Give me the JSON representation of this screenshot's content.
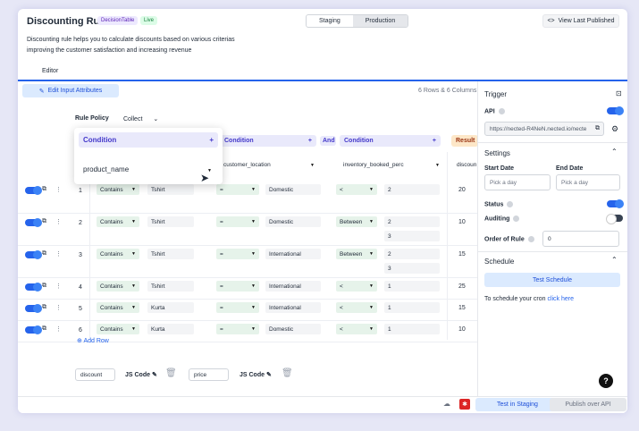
{
  "header": {
    "title": "Discounting Rule",
    "badge_type": "DecisionTable",
    "badge_status": "Live",
    "env_staging": "Staging",
    "env_production": "Production",
    "view_published": "View Last Published",
    "description_line1": "Discounting rule helps you to calculate discounts based on various criterias",
    "description_line2": "improving the customer satisfaction and increasing revenue",
    "tab_editor": "Editor"
  },
  "toolbar": {
    "edit_input": "Edit Input Attributes",
    "size_info": "6 Rows & 6 Columns"
  },
  "policy": {
    "label": "Rule Policy",
    "value": "Collect"
  },
  "columns": {
    "condition_label": "Condition",
    "and_label": "And",
    "result_label": "Result",
    "col1_attr": "product_name",
    "col2_attr": "customer_location",
    "col3_attr": "inventory_booked_perc",
    "col4_attr": "discoun"
  },
  "rows": [
    {
      "num": "1",
      "op1": "Contains",
      "v1": "Tshirt",
      "op2": "=",
      "v2": "Domestic",
      "op3": "<",
      "v3": "2",
      "v3b": "",
      "res": "20"
    },
    {
      "num": "2",
      "op1": "Contains",
      "v1": "Tshirt",
      "op2": "=",
      "v2": "Domestic",
      "op3": "Between",
      "v3": "2",
      "v3b": "3",
      "res": "10"
    },
    {
      "num": "3",
      "op1": "Contains",
      "v1": "Tshirt",
      "op2": "=",
      "v2": "International",
      "op3": "Between",
      "v3": "2",
      "v3b": "3",
      "res": "15"
    },
    {
      "num": "4",
      "op1": "Contains",
      "v1": "Tshirt",
      "op2": "=",
      "v2": "International",
      "op3": "<",
      "v3": "1",
      "v3b": "",
      "res": "25"
    },
    {
      "num": "5",
      "op1": "Contains",
      "v1": "Kurta",
      "op2": "=",
      "v2": "International",
      "op3": "<",
      "v3": "1",
      "v3b": "",
      "res": "15"
    },
    {
      "num": "6",
      "op1": "Contains",
      "v1": "Kurta",
      "op2": "=",
      "v2": "Domestic",
      "op3": "<",
      "v3": "1",
      "v3b": "",
      "res": "10"
    }
  ],
  "add_row": "Add Row",
  "footer_vars": {
    "var1": "discount",
    "var2": "price",
    "js_code": "JS Code"
  },
  "trigger": {
    "title": "Trigger",
    "api_label": "API",
    "url": "https://nected-R4NeN.nected.io/necte",
    "settings_title": "Settings",
    "start_date_label": "Start Date",
    "end_date_label": "End Date",
    "date_placeholder": "Pick a day",
    "status_label": "Status",
    "auditing_label": "Auditing",
    "order_label": "Order of Rule",
    "order_value": "0",
    "schedule_title": "Schedule",
    "test_schedule": "Test Schedule",
    "cron_text": "To schedule your cron ",
    "cron_link": "click here"
  },
  "bottom": {
    "test_staging": "Test in Staging",
    "publish_api": "Publish over API"
  },
  "colors": {
    "accent": "#2563eb",
    "condition_bg": "#e9e9fb",
    "status_live": "#dcfce7",
    "result_bg": "#fde7c8",
    "error": "#dc2626"
  }
}
